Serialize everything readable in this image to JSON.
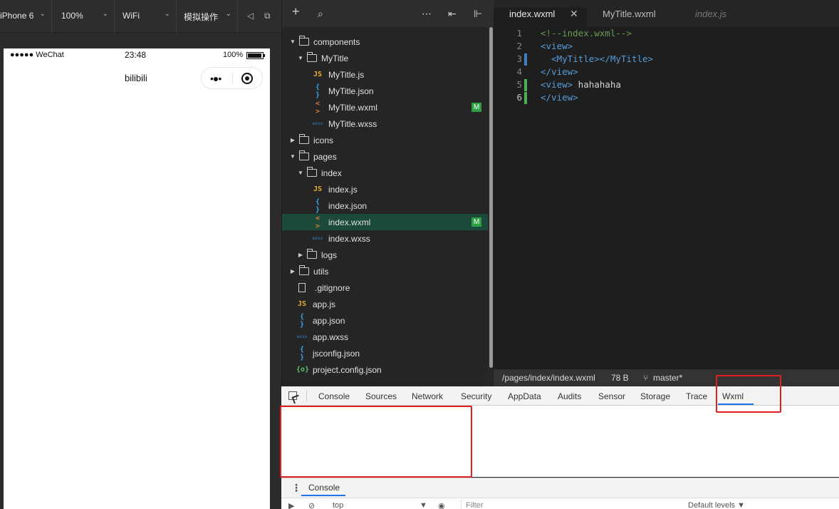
{
  "simulator": {
    "device": "iPhone 6",
    "zoom": "100%",
    "network": "WiFi",
    "operation": "模拟操作",
    "status_bar": {
      "carrier": "●●●●● WeChat",
      "time": "23:48",
      "battery": "100%"
    },
    "nav_title": "bilibili"
  },
  "file_tree": [
    {
      "label": "components",
      "kind": "folder",
      "open": true,
      "indent": 0
    },
    {
      "label": "MyTitle",
      "kind": "folder",
      "open": true,
      "indent": 1
    },
    {
      "label": "MyTitle.js",
      "kind": "js",
      "indent": 2,
      "icon_text": "JS"
    },
    {
      "label": "MyTitle.json",
      "kind": "json",
      "indent": 2,
      "icon_text": "{ }"
    },
    {
      "label": "MyTitle.wxml",
      "kind": "wxml",
      "indent": 2,
      "icon_text": "< >",
      "badge": "M"
    },
    {
      "label": "MyTitle.wxss",
      "kind": "wxss",
      "indent": 2,
      "icon_text": "wxss"
    },
    {
      "label": "icons",
      "kind": "folder",
      "open": false,
      "indent": 0
    },
    {
      "label": "pages",
      "kind": "folder",
      "open": true,
      "indent": 0
    },
    {
      "label": "index",
      "kind": "folder",
      "open": true,
      "indent": 1
    },
    {
      "label": "index.js",
      "kind": "js",
      "indent": 2,
      "icon_text": "JS"
    },
    {
      "label": "index.json",
      "kind": "json",
      "indent": 2,
      "icon_text": "{ }"
    },
    {
      "label": "index.wxml",
      "kind": "wxml",
      "indent": 2,
      "icon_text": "< >",
      "badge": "M",
      "selected": true
    },
    {
      "label": "index.wxss",
      "kind": "wxss",
      "indent": 2,
      "icon_text": "wxss"
    },
    {
      "label": "logs",
      "kind": "folder",
      "open": false,
      "indent": 1
    },
    {
      "label": "utils",
      "kind": "folder",
      "open": false,
      "indent": 0
    },
    {
      "label": ".gitignore",
      "kind": "file",
      "indent": 0
    },
    {
      "label": "app.js",
      "kind": "js",
      "indent": 0,
      "icon_text": "JS"
    },
    {
      "label": "app.json",
      "kind": "json",
      "indent": 0,
      "icon_text": "{ }"
    },
    {
      "label": "app.wxss",
      "kind": "wxss",
      "indent": 0,
      "icon_text": "wxss"
    },
    {
      "label": "jsconfig.json",
      "kind": "json",
      "indent": 0,
      "icon_text": "{ }"
    },
    {
      "label": "project.config.json",
      "kind": "cfg",
      "indent": 0,
      "icon_text": "{o}"
    }
  ],
  "editor": {
    "tabs": [
      {
        "label": "index.wxml",
        "state": "active"
      },
      {
        "label": "MyTitle.wxml",
        "state": "normal"
      },
      {
        "label": "index.js",
        "state": "preview"
      }
    ],
    "lines": [
      {
        "num": "1",
        "parts": [
          [
            "c-com",
            "<!--index.wxml-->"
          ]
        ]
      },
      {
        "num": "2",
        "parts": [
          [
            "c-tag",
            "<view>"
          ]
        ]
      },
      {
        "num": "3",
        "parts": [
          [
            "c-txt",
            "  "
          ],
          [
            "c-tag",
            "<MyTitle></MyTitle>"
          ]
        ],
        "mark": "#3f7fbf"
      },
      {
        "num": "4",
        "parts": [
          [
            "c-tag",
            "</view>"
          ]
        ]
      },
      {
        "num": "5",
        "parts": [
          [
            "c-tag",
            "<view>"
          ],
          [
            "c-txt",
            " hahahaha"
          ]
        ],
        "mark": "#4caf50"
      },
      {
        "num": "6",
        "parts": [
          [
            "c-tag",
            "</view>"
          ]
        ],
        "mark": "#4caf50",
        "current": true
      }
    ],
    "status": {
      "path": "/pages/index/index.wxml",
      "size": "78 B",
      "branch": "master*"
    }
  },
  "devtools": {
    "tabs": [
      "Console",
      "Sources",
      "Network",
      "Security",
      "AppData",
      "Audits",
      "Sensor",
      "Storage",
      "Trace",
      "Wxml"
    ],
    "active_tab": "Wxml",
    "drawer_tab": "Console",
    "context": "top",
    "filter_placeholder": "Filter",
    "levels": "Default levels ▼"
  }
}
